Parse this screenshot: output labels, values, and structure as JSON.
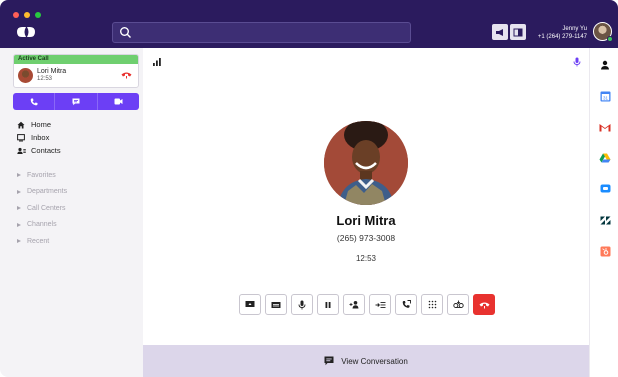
{
  "window": {
    "traffic_lights": [
      "close",
      "minimize",
      "maximize"
    ]
  },
  "topbar": {
    "logo_icon": "dialpad-logo-icon",
    "search": {
      "value": "",
      "placeholder": ""
    },
    "user": {
      "name": "Jenny Yu",
      "phone": "+1 (264) 279-1147",
      "status_color": "#3bc45d"
    },
    "buttons": [
      "megaphone-icon",
      "sidebar-toggle-icon"
    ]
  },
  "sidebar": {
    "active_call": {
      "header": "Active Call",
      "caller_name": "Lori Mitra",
      "duration": "12:53",
      "header_color": "#6fcf6f"
    },
    "actions": [
      "phone-icon",
      "message-icon",
      "video-icon"
    ],
    "nav": [
      {
        "icon": "home-icon",
        "label": "Home"
      },
      {
        "icon": "inbox-icon",
        "label": "Inbox"
      },
      {
        "icon": "contacts-icon",
        "label": "Contacts"
      }
    ],
    "groups": [
      "Favorites",
      "Departments",
      "Call Centers",
      "Channels",
      "Recent"
    ]
  },
  "main": {
    "contact": {
      "name": "Lori Mitra",
      "phone": "(265) 973-3008",
      "duration": "12:53"
    },
    "controls": [
      "screen-share-icon",
      "keypad-text-icon",
      "mute-icon",
      "hold-icon",
      "add-caller-icon",
      "transfer-icon",
      "call-forward-icon",
      "dialpad-icon",
      "voicemail-drop-icon",
      "hang-up-icon"
    ],
    "view_conversation": "View Conversation",
    "accent_color": "#6c3ff5",
    "end_call_color": "#e8322f"
  },
  "rail": [
    "contact-icon",
    "calendar-icon",
    "gmail-icon",
    "drive-icon",
    "chat-icon",
    "zendesk-icon",
    "hubspot-icon"
  ]
}
